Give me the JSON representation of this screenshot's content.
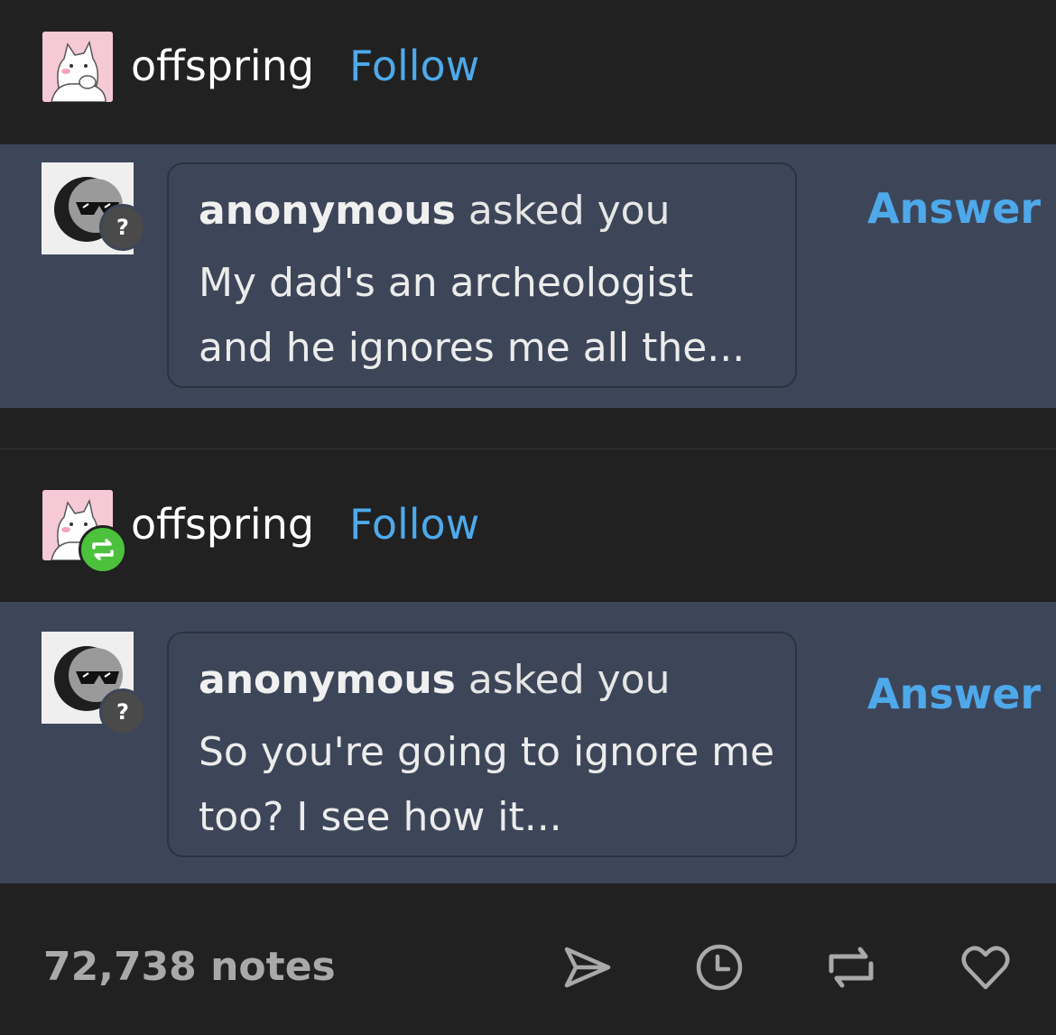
{
  "posts": [
    {
      "username": "offspring",
      "follow_label": "Follow",
      "ask": {
        "asker": "anonymous",
        "asked_text": "asked you",
        "question": "My dad's an archeologist and he ignores me all the...",
        "answer_label": "Answer"
      }
    },
    {
      "username": "offspring",
      "follow_label": "Follow",
      "ask": {
        "asker": "anonymous",
        "asked_text": "asked you",
        "question": "So you're going to ignore me too? I see how it...",
        "answer_label": "Answer"
      }
    }
  ],
  "footer": {
    "notes": "72,738 notes",
    "icons": [
      "share-icon",
      "history-icon",
      "reblog-icon",
      "like-icon"
    ]
  },
  "colors": {
    "background": "#212121",
    "ask_panel": "#3d4659",
    "accent": "#4ea9ea",
    "reblog_green": "#4cc13c"
  }
}
